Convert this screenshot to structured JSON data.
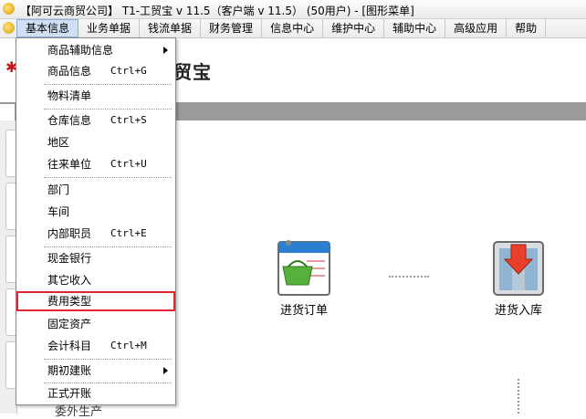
{
  "window": {
    "title": "【阿可云商贸公司】 T1-工贸宝 v 11.5（客户端 v 11.5） (50用户) - [图形菜单]"
  },
  "menubar": {
    "items": [
      "基本信息",
      "业务单据",
      "钱流单据",
      "财务管理",
      "信息中心",
      "维护中心",
      "辅助中心",
      "高级应用",
      "帮助"
    ]
  },
  "brand": {
    "logo_text": "贸宝"
  },
  "dropdown": {
    "items": [
      {
        "label": "商品辅助信息",
        "shortcut": "",
        "submenu": true
      },
      {
        "label": "商品信息",
        "shortcut": "Ctrl+G",
        "submenu": false
      },
      {
        "label": "物料清单",
        "shortcut": "",
        "submenu": false
      },
      {
        "label": "仓库信息",
        "shortcut": "Ctrl+S",
        "submenu": false
      },
      {
        "label": "地区",
        "shortcut": "",
        "submenu": false
      },
      {
        "label": "往来单位",
        "shortcut": "Ctrl+U",
        "submenu": false
      },
      {
        "label": "部门",
        "shortcut": "",
        "submenu": false
      },
      {
        "label": "车间",
        "shortcut": "",
        "submenu": false
      },
      {
        "label": "内部职员",
        "shortcut": "Ctrl+E",
        "submenu": false
      },
      {
        "label": "现金银行",
        "shortcut": "",
        "submenu": false
      },
      {
        "label": "其它收入",
        "shortcut": "",
        "submenu": false
      },
      {
        "label": "费用类型",
        "shortcut": "",
        "submenu": false
      },
      {
        "label": "固定资产",
        "shortcut": "",
        "submenu": false
      },
      {
        "label": "会计科目",
        "shortcut": "Ctrl+M",
        "submenu": false
      },
      {
        "label": "期初建账",
        "shortcut": "",
        "submenu": true
      },
      {
        "label": "正式开账",
        "shortcut": "",
        "submenu": false
      }
    ]
  },
  "flow": {
    "nodes": [
      {
        "label": "进货订单",
        "icon": "purchase-order-icon"
      },
      {
        "label": "进货入库",
        "icon": "warehouse-inbound-icon"
      }
    ],
    "partial_label": "委外生产"
  },
  "colors": {
    "highlight": "#e0262f",
    "menu_active": "#cfe0f4",
    "brand_red": "#c9141b"
  }
}
